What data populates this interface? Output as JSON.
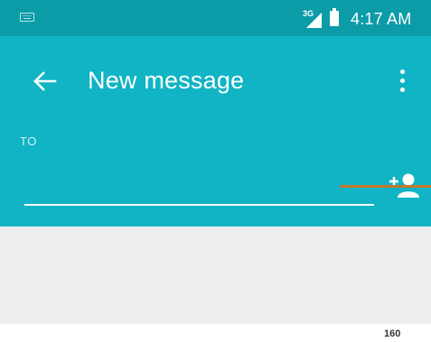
{
  "status_bar": {
    "network_label": "3G",
    "time": "4:17 AM",
    "icons": [
      "keyboard-icon",
      "signal-icon",
      "battery-icon"
    ]
  },
  "app_bar": {
    "title": "New message",
    "back_icon": "arrow-left-icon",
    "overflow_icon": "more-vertical-icon"
  },
  "recipient": {
    "label": "TO",
    "value": "",
    "add_contact_icon": "add-person-icon"
  },
  "compose": {
    "char_count": "160"
  },
  "colors": {
    "status_bar": "#0c9ca8",
    "app_bar": "#10b4c4",
    "compose_bg": "#eeeeee",
    "accent_line": "#c6772e"
  }
}
